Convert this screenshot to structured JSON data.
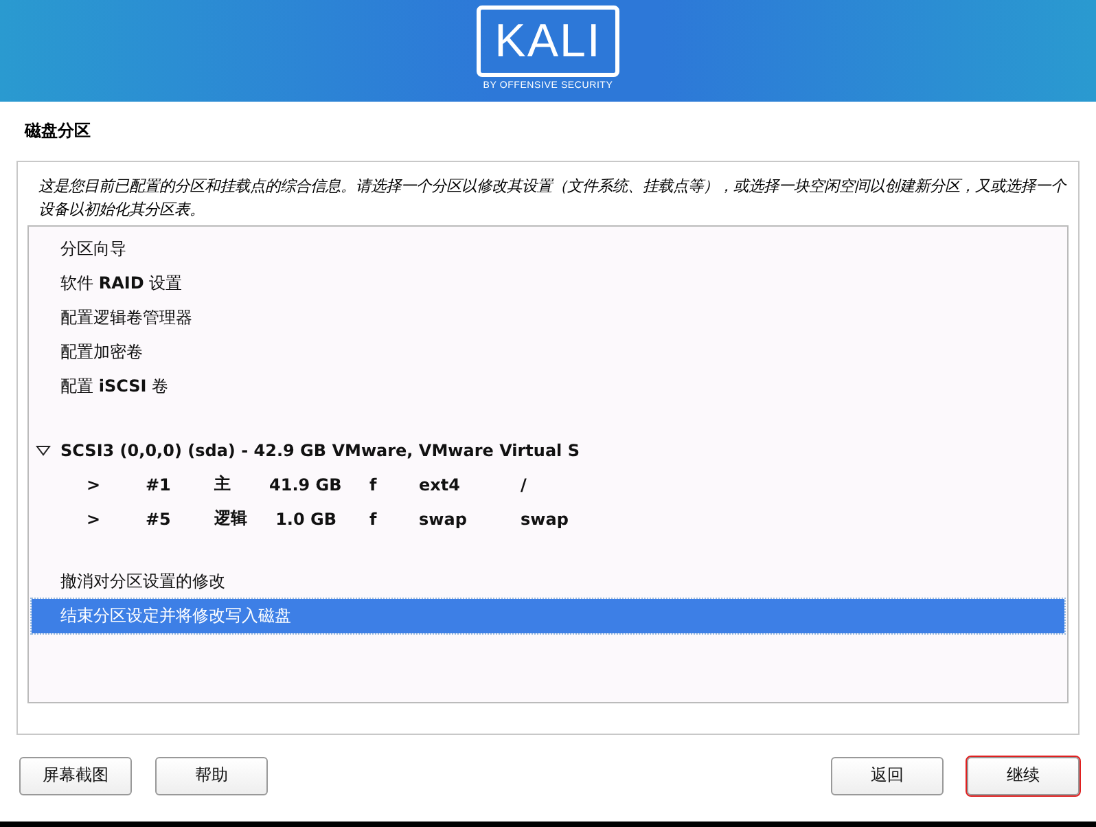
{
  "banner": {
    "logo_text": "KALI",
    "tagline": "BY OFFENSIVE SECURITY"
  },
  "page_title": "磁盘分区",
  "description": "这是您目前已配置的分区和挂载点的综合信息。请选择一个分区以修改其设置（文件系统、挂载点等），或选择一块空闲空间以创建新分区，又或选择一个设备以初始化其分区表。",
  "list": [
    {
      "kind": "action",
      "label": "分区向导",
      "selected": false
    },
    {
      "kind": "action",
      "label": "软件 **RAID** 设置",
      "selected": false
    },
    {
      "kind": "action",
      "label": "配置逻辑卷管理器",
      "selected": false
    },
    {
      "kind": "action",
      "label": "配置加密卷",
      "selected": false
    },
    {
      "kind": "action",
      "label": "配置 **iSCSI** 卷",
      "selected": false
    },
    {
      "kind": "spacer"
    },
    {
      "kind": "disk",
      "label": "SCSI3 (0,0,0) (sda) - 42.9 GB VMware, VMware Virtual S",
      "expanded": true,
      "selected": false
    },
    {
      "kind": "partition",
      "cells": [
        ">",
        "#1",
        "主",
        "41.9 GB",
        "f",
        "ext4",
        "/"
      ],
      "selected": false
    },
    {
      "kind": "partition",
      "cells": [
        ">",
        "#5",
        "逻辑",
        "1.0 GB",
        "f",
        "swap",
        "swap"
      ],
      "selected": false
    },
    {
      "kind": "spacer"
    },
    {
      "kind": "action",
      "label": "撤消对分区设置的修改",
      "selected": false
    },
    {
      "kind": "action",
      "label": "结束分区设定并将修改写入磁盘",
      "selected": true
    }
  ],
  "left_buttons": [
    {
      "label": "屏幕截图"
    },
    {
      "label": "帮助"
    }
  ],
  "right_buttons": [
    {
      "label": "返回",
      "annotated": false
    },
    {
      "label": "继续",
      "annotated": true
    }
  ]
}
